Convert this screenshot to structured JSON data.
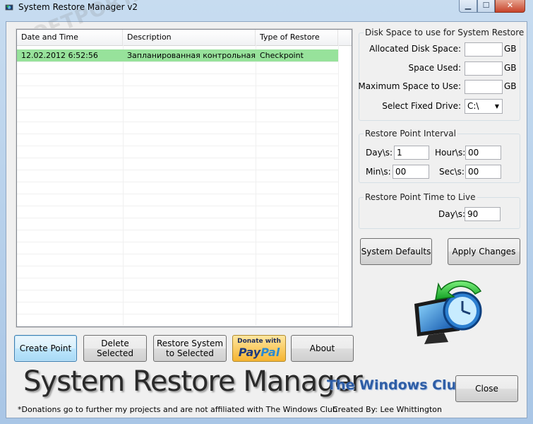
{
  "window": {
    "title": "System Restore Manager v2",
    "controls": {
      "minimize": "▁",
      "maximize": "☐",
      "close": "✕"
    },
    "watermark": "SOFTPORTAL"
  },
  "restore_list": {
    "columns": [
      "Date and Time",
      "Description",
      "Type of Restore Point"
    ],
    "rows": [
      {
        "date": "12.02.2012 6:52:56",
        "description": "Запланированная контрольная т...",
        "type": "Checkpoint",
        "selected": true
      }
    ],
    "selected_color": "#97e29b"
  },
  "disk_space": {
    "title": "Disk Space to use for System Restore",
    "allocated_label": "Allocated Disk Space:",
    "allocated_value": "",
    "used_label": "Space Used:",
    "used_value": "",
    "max_label": "Maximum Space to Use:",
    "max_value": "",
    "unit": "GB",
    "drive_label": "Select Fixed Drive:",
    "drive_value": "C:\\"
  },
  "interval": {
    "title": "Restore Point Interval",
    "days_label": "Day\\s:",
    "days_value": "1",
    "hours_label": "Hour\\s:",
    "hours_value": "00",
    "mins_label": "Min\\s:",
    "mins_value": "00",
    "secs_label": "Sec\\s:",
    "secs_value": "00"
  },
  "ttl": {
    "title": "Restore Point Time to Live",
    "days_label": "Day\\s:",
    "days_value": "90"
  },
  "buttons": {
    "system_defaults": "System Defaults",
    "apply_changes": "Apply Changes",
    "create_point": "Create Point",
    "delete_selected_1": "Delete",
    "delete_selected_2": "Selected",
    "restore_1": "Restore System",
    "restore_2": "to Selected",
    "about": "About",
    "close": "Close"
  },
  "paypal": {
    "donate": "Donate with",
    "logo_a": "Pay",
    "logo_b": "Pal"
  },
  "branding": {
    "app_title": "System Restore Manager",
    "club": "The Windows Club",
    "footnote": "*Donations go to further my projects and are not affiliated with The Windows Club",
    "author": "Created By: Lee Whittington"
  },
  "icons": [
    "app-icon",
    "restore-monitor-icon",
    "combo-arrow-icon"
  ]
}
